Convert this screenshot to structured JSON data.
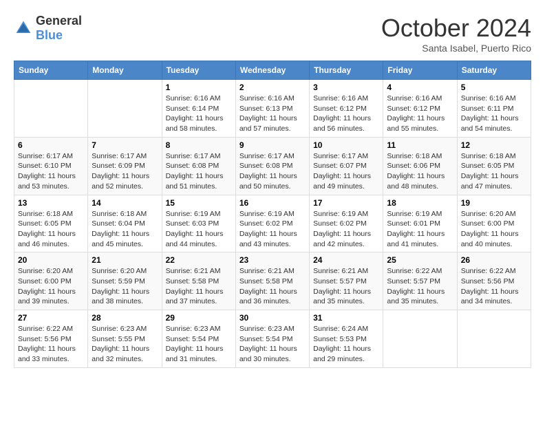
{
  "header": {
    "logo_general": "General",
    "logo_blue": "Blue",
    "month_title": "October 2024",
    "subtitle": "Santa Isabel, Puerto Rico"
  },
  "days_of_week": [
    "Sunday",
    "Monday",
    "Tuesday",
    "Wednesday",
    "Thursday",
    "Friday",
    "Saturday"
  ],
  "weeks": [
    [
      {
        "day": "",
        "info": ""
      },
      {
        "day": "",
        "info": ""
      },
      {
        "day": "1",
        "info": "Sunrise: 6:16 AM\nSunset: 6:14 PM\nDaylight: 11 hours and 58 minutes."
      },
      {
        "day": "2",
        "info": "Sunrise: 6:16 AM\nSunset: 6:13 PM\nDaylight: 11 hours and 57 minutes."
      },
      {
        "day": "3",
        "info": "Sunrise: 6:16 AM\nSunset: 6:12 PM\nDaylight: 11 hours and 56 minutes."
      },
      {
        "day": "4",
        "info": "Sunrise: 6:16 AM\nSunset: 6:12 PM\nDaylight: 11 hours and 55 minutes."
      },
      {
        "day": "5",
        "info": "Sunrise: 6:16 AM\nSunset: 6:11 PM\nDaylight: 11 hours and 54 minutes."
      }
    ],
    [
      {
        "day": "6",
        "info": "Sunrise: 6:17 AM\nSunset: 6:10 PM\nDaylight: 11 hours and 53 minutes."
      },
      {
        "day": "7",
        "info": "Sunrise: 6:17 AM\nSunset: 6:09 PM\nDaylight: 11 hours and 52 minutes."
      },
      {
        "day": "8",
        "info": "Sunrise: 6:17 AM\nSunset: 6:08 PM\nDaylight: 11 hours and 51 minutes."
      },
      {
        "day": "9",
        "info": "Sunrise: 6:17 AM\nSunset: 6:08 PM\nDaylight: 11 hours and 50 minutes."
      },
      {
        "day": "10",
        "info": "Sunrise: 6:17 AM\nSunset: 6:07 PM\nDaylight: 11 hours and 49 minutes."
      },
      {
        "day": "11",
        "info": "Sunrise: 6:18 AM\nSunset: 6:06 PM\nDaylight: 11 hours and 48 minutes."
      },
      {
        "day": "12",
        "info": "Sunrise: 6:18 AM\nSunset: 6:05 PM\nDaylight: 11 hours and 47 minutes."
      }
    ],
    [
      {
        "day": "13",
        "info": "Sunrise: 6:18 AM\nSunset: 6:05 PM\nDaylight: 11 hours and 46 minutes."
      },
      {
        "day": "14",
        "info": "Sunrise: 6:18 AM\nSunset: 6:04 PM\nDaylight: 11 hours and 45 minutes."
      },
      {
        "day": "15",
        "info": "Sunrise: 6:19 AM\nSunset: 6:03 PM\nDaylight: 11 hours and 44 minutes."
      },
      {
        "day": "16",
        "info": "Sunrise: 6:19 AM\nSunset: 6:02 PM\nDaylight: 11 hours and 43 minutes."
      },
      {
        "day": "17",
        "info": "Sunrise: 6:19 AM\nSunset: 6:02 PM\nDaylight: 11 hours and 42 minutes."
      },
      {
        "day": "18",
        "info": "Sunrise: 6:19 AM\nSunset: 6:01 PM\nDaylight: 11 hours and 41 minutes."
      },
      {
        "day": "19",
        "info": "Sunrise: 6:20 AM\nSunset: 6:00 PM\nDaylight: 11 hours and 40 minutes."
      }
    ],
    [
      {
        "day": "20",
        "info": "Sunrise: 6:20 AM\nSunset: 6:00 PM\nDaylight: 11 hours and 39 minutes."
      },
      {
        "day": "21",
        "info": "Sunrise: 6:20 AM\nSunset: 5:59 PM\nDaylight: 11 hours and 38 minutes."
      },
      {
        "day": "22",
        "info": "Sunrise: 6:21 AM\nSunset: 5:58 PM\nDaylight: 11 hours and 37 minutes."
      },
      {
        "day": "23",
        "info": "Sunrise: 6:21 AM\nSunset: 5:58 PM\nDaylight: 11 hours and 36 minutes."
      },
      {
        "day": "24",
        "info": "Sunrise: 6:21 AM\nSunset: 5:57 PM\nDaylight: 11 hours and 35 minutes."
      },
      {
        "day": "25",
        "info": "Sunrise: 6:22 AM\nSunset: 5:57 PM\nDaylight: 11 hours and 35 minutes."
      },
      {
        "day": "26",
        "info": "Sunrise: 6:22 AM\nSunset: 5:56 PM\nDaylight: 11 hours and 34 minutes."
      }
    ],
    [
      {
        "day": "27",
        "info": "Sunrise: 6:22 AM\nSunset: 5:56 PM\nDaylight: 11 hours and 33 minutes."
      },
      {
        "day": "28",
        "info": "Sunrise: 6:23 AM\nSunset: 5:55 PM\nDaylight: 11 hours and 32 minutes."
      },
      {
        "day": "29",
        "info": "Sunrise: 6:23 AM\nSunset: 5:54 PM\nDaylight: 11 hours and 31 minutes."
      },
      {
        "day": "30",
        "info": "Sunrise: 6:23 AM\nSunset: 5:54 PM\nDaylight: 11 hours and 30 minutes."
      },
      {
        "day": "31",
        "info": "Sunrise: 6:24 AM\nSunset: 5:53 PM\nDaylight: 11 hours and 29 minutes."
      },
      {
        "day": "",
        "info": ""
      },
      {
        "day": "",
        "info": ""
      }
    ]
  ]
}
